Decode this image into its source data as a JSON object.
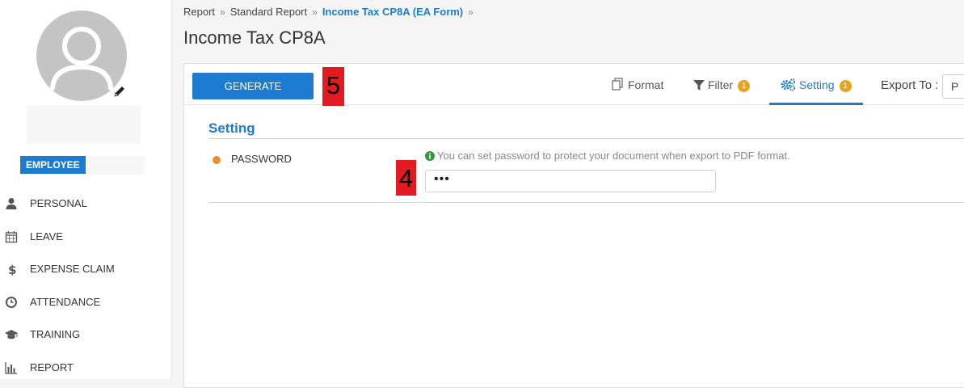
{
  "sidebar": {
    "role_badge": "EMPLOYEE",
    "menu": [
      {
        "label": "PERSONAL",
        "icon": "user-icon"
      },
      {
        "label": "LEAVE",
        "icon": "calendar-icon"
      },
      {
        "label": "EXPENSE CLAIM",
        "icon": "dollar-icon"
      },
      {
        "label": "ATTENDANCE",
        "icon": "clock-icon"
      },
      {
        "label": "TRAINING",
        "icon": "graduation-cap-icon"
      },
      {
        "label": "REPORT",
        "icon": "bar-chart-icon"
      }
    ]
  },
  "breadcrumb": {
    "items": [
      "Report",
      "Standard Report",
      "Income Tax CP8A (EA Form)"
    ],
    "separator": "»"
  },
  "page_title": "Income Tax CP8A",
  "toolbar": {
    "generate_label": "GENERATE",
    "tabs": [
      {
        "label": "Format",
        "icon": "copy-icon",
        "badge": null
      },
      {
        "label": "Filter",
        "icon": "filter-icon",
        "badge": "1"
      },
      {
        "label": "Setting",
        "icon": "cogs-icon",
        "badge": "1",
        "active": true
      }
    ],
    "export_label": "Export To :",
    "export_value": "P"
  },
  "annotations": {
    "generate_step": "5",
    "password_step": "4"
  },
  "setting": {
    "section_title": "Setting",
    "password_label": "PASSWORD",
    "hint": "You can set password to protect your document when export to PDF format.",
    "password_value": "•••"
  },
  "colors": {
    "accent": "#1d7ccf",
    "badge": "#e8a317",
    "marker": "#e21b23",
    "dot": "#e8902a"
  }
}
